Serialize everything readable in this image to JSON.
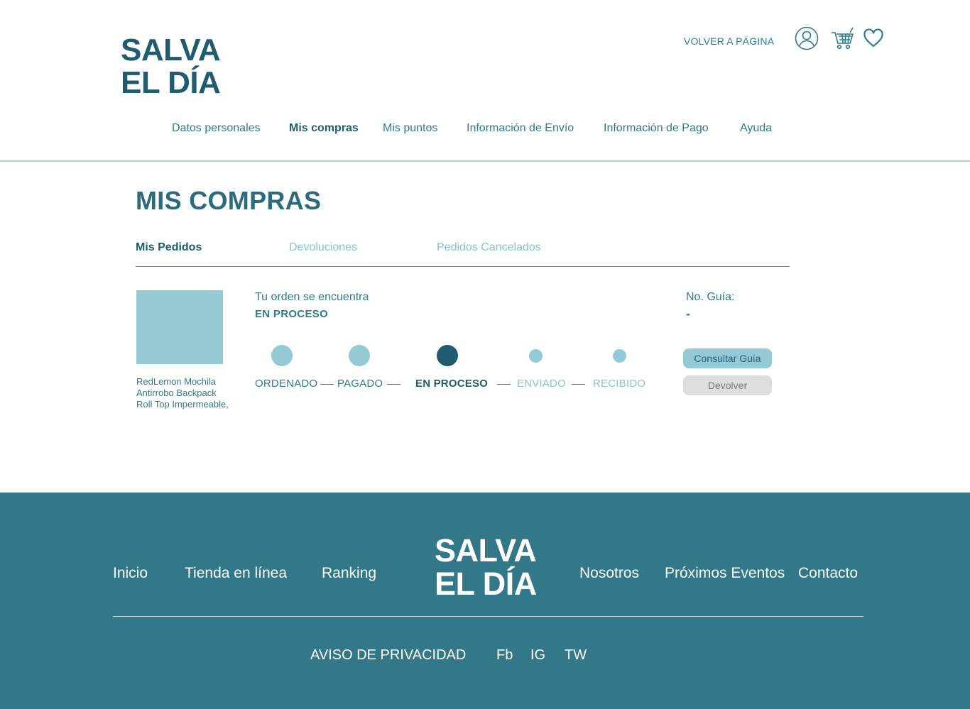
{
  "header": {
    "logo_line1": "SALVA",
    "logo_line2": "EL DÍA",
    "volver": "VOLVER A PÁGINA",
    "icons": [
      "user-icon",
      "cart-icon",
      "heart-icon"
    ]
  },
  "nav": {
    "items": [
      {
        "label": "Datos personales"
      },
      {
        "label": "Mis compras"
      },
      {
        "label": "Mis puntos"
      },
      {
        "label": "Información de Envío"
      },
      {
        "label": "Información de Pago"
      },
      {
        "label": "Ayuda"
      }
    ],
    "active": "Mis compras"
  },
  "main": {
    "title": "MIS COMPRAS",
    "tabs": [
      {
        "label": "Mis Pedidos"
      },
      {
        "label": "Devoluciones"
      },
      {
        "label": "Pedidos Cancelados"
      }
    ],
    "active_tab": "Mis Pedidos",
    "order": {
      "product_name": "RedLemon Mochila Antirrobo Backpack Roll Top Impermeable,",
      "status_label": "Tu orden se encuentra",
      "status_value": "EN PROCESO",
      "steps": [
        {
          "label": "ORDENADO"
        },
        {
          "label": "PAGADO"
        },
        {
          "label": "EN PROCESO"
        },
        {
          "label": "ENVIADO"
        },
        {
          "label": "RECIBIDO"
        }
      ],
      "current_step": "EN PROCESO",
      "guia_label": "No. Guía:",
      "guia_value": "-",
      "consultar_label": "Consultar Guía",
      "devolver_label": "Devolver"
    }
  },
  "footer": {
    "links": [
      {
        "label": "Inicio"
      },
      {
        "label": "Tienda en línea"
      },
      {
        "label": "Ranking"
      },
      {
        "label": "Nosotros"
      },
      {
        "label": "Próximos Eventos"
      },
      {
        "label": "Contacto"
      }
    ],
    "logo_line1": "SALVA",
    "logo_line2": "EL DÍA",
    "privacy": "AVISO DE PRIVACIDAD",
    "social": [
      {
        "label": "Fb"
      },
      {
        "label": "IG"
      },
      {
        "label": "TW"
      }
    ]
  },
  "colors": {
    "primary_dark": "#1f5c70",
    "primary": "#2f7a90",
    "light": "#93cad6",
    "footer_bg": "#327889"
  }
}
